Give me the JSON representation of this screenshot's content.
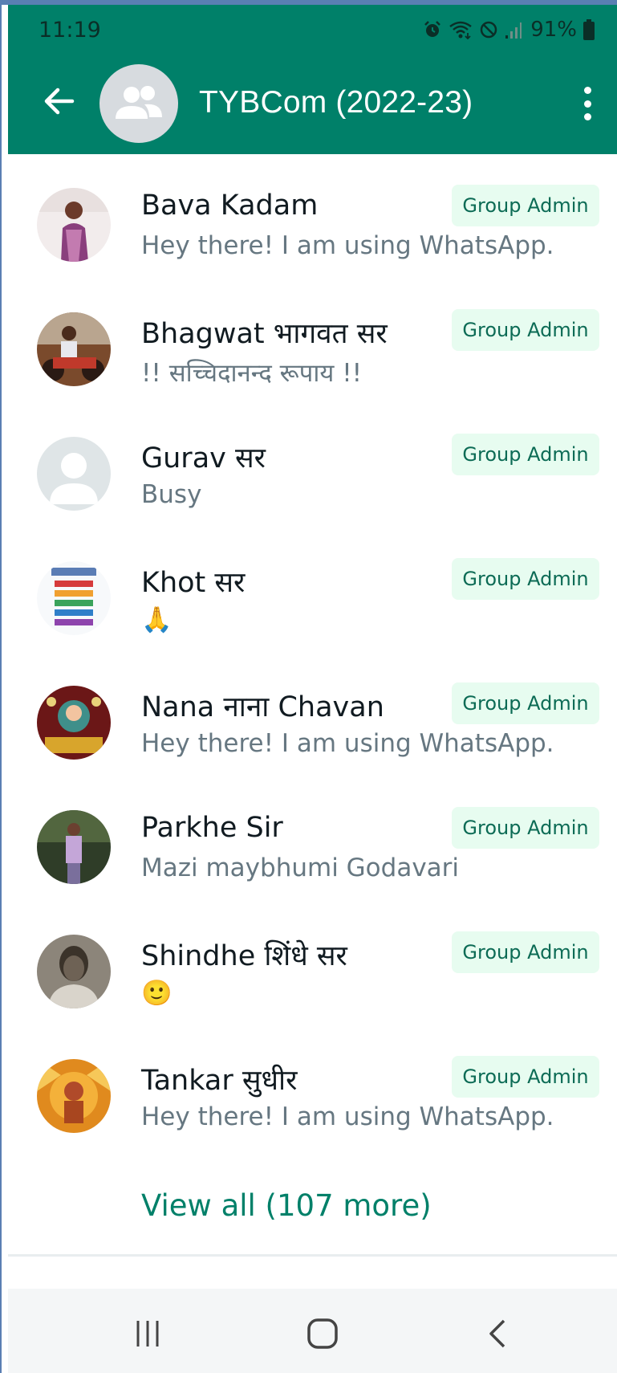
{
  "status_bar": {
    "time": "11:19",
    "battery": "91%",
    "icons": [
      "alarm-icon",
      "wifi-icon",
      "dnd-icon",
      "signal-icon",
      "battery-icon"
    ]
  },
  "header": {
    "title": "TYBCom (2022-23)",
    "background": "#008069",
    "icons": [
      "back-arrow-icon",
      "group-avatar-icon",
      "more-vert-icon"
    ]
  },
  "participants": [
    {
      "name": "Bava Kadam",
      "status": "Hey there! I am using WhatsApp.",
      "badge": "Group Admin"
    },
    {
      "name": "Bhagwat भागवत सर",
      "status": "!! सच्चिदानन्द रूपाय !!",
      "badge": "Group Admin"
    },
    {
      "name": "Gurav सर",
      "status": "Busy",
      "badge": "Group Admin"
    },
    {
      "name": "Khot सर",
      "status": "🙏",
      "badge": "Group Admin"
    },
    {
      "name": "Nana नाना Chavan",
      "status": "Hey there! I am using WhatsApp.",
      "badge": "Group Admin"
    },
    {
      "name": "Parkhe Sir",
      "status": "Mazi maybhumi Godavari",
      "badge": "Group Admin"
    },
    {
      "name": "Shindhe शिंधे सर",
      "status": "🙂",
      "badge": "Group Admin"
    },
    {
      "name": "Tankar सुधीर",
      "status": "Hey there! I am using WhatsApp.",
      "badge": "Group Admin"
    }
  ],
  "view_all": "View all (107 more)",
  "nav_bar": {
    "icons": [
      "recents-icon",
      "home-icon",
      "back-icon"
    ]
  },
  "colors": {
    "accent": "#008069",
    "badge_bg": "#e7fcf0",
    "badge_text": "#0c6b55",
    "secondary_text": "#667781"
  }
}
